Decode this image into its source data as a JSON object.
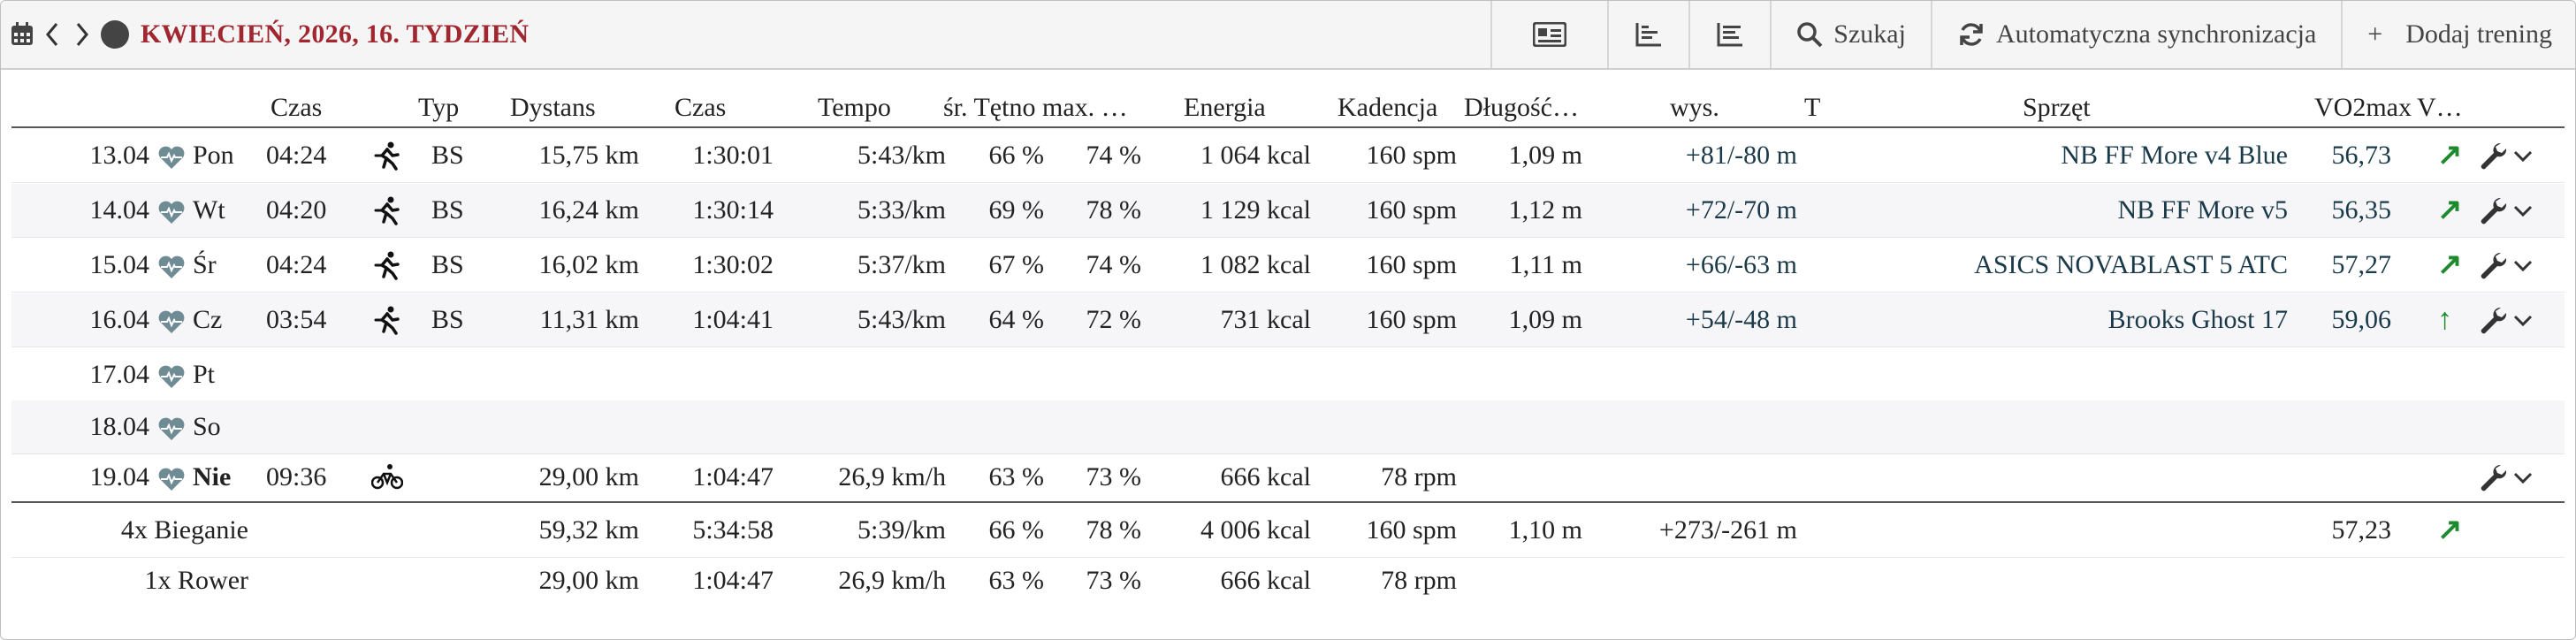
{
  "toolbar": {
    "title": "KWIECIEŃ, 2026, 16. TYDZIEŃ",
    "search_label": "Szukaj",
    "sync_label": "Automatyczna synchronizacja",
    "add_label": "Dodaj trening",
    "add_plus": "+"
  },
  "columns": {
    "czas1": "Czas",
    "typ": "Typ",
    "dystans": "Dystans",
    "czas2": "Czas",
    "tempo": "Tempo",
    "sr": "śr. Tętno",
    "max": "max. …",
    "energia": "Energia",
    "kadencja": "Kadencja",
    "dlugosc": "Długość…",
    "wys": "wys.",
    "t": "T",
    "sprzet": "Sprzęt",
    "vo2": "VO2max",
    "v": "V…"
  },
  "rows": [
    {
      "date": "13.04",
      "day": "Pon",
      "time": "04:24",
      "icon": "running-icon",
      "typ": "BS",
      "dist": "15,75 km",
      "dur": "1:30:01",
      "tempo": "5:43/km",
      "avg": "66 %",
      "max": "74 %",
      "energy": "1 064 kcal",
      "cad": "160 spm",
      "len": "1,09 m",
      "elev": "+81/-80 m",
      "gear": "NB FF More v4 Blue",
      "vo2": "56,73",
      "trend": "↗"
    },
    {
      "date": "14.04",
      "day": "Wt",
      "time": "04:20",
      "icon": "running-icon",
      "typ": "BS",
      "dist": "16,24 km",
      "dur": "1:30:14",
      "tempo": "5:33/km",
      "avg": "69 %",
      "max": "78 %",
      "energy": "1 129 kcal",
      "cad": "160 spm",
      "len": "1,12 m",
      "elev": "+72/-70 m",
      "gear": "NB FF More v5",
      "vo2": "56,35",
      "trend": "↗"
    },
    {
      "date": "15.04",
      "day": "Śr",
      "time": "04:24",
      "icon": "running-icon",
      "typ": "BS",
      "dist": "16,02 km",
      "dur": "1:30:02",
      "tempo": "5:37/km",
      "avg": "67 %",
      "max": "74 %",
      "energy": "1 082 kcal",
      "cad": "160 spm",
      "len": "1,11 m",
      "elev": "+66/-63 m",
      "gear": "ASICS NOVABLAST 5 ATC",
      "vo2": "57,27",
      "trend": "↗"
    },
    {
      "date": "16.04",
      "day": "Cz",
      "time": "03:54",
      "icon": "running-icon",
      "typ": "BS",
      "dist": "11,31 km",
      "dur": "1:04:41",
      "tempo": "5:43/km",
      "avg": "64 %",
      "max": "72 %",
      "energy": "731 kcal",
      "cad": "160 spm",
      "len": "1,09 m",
      "elev": "+54/-48 m",
      "gear": "Brooks Ghost 17",
      "vo2": "59,06",
      "trend": "↑"
    },
    {
      "date": "17.04",
      "day": "Pt"
    },
    {
      "date": "18.04",
      "day": "So"
    },
    {
      "date": "19.04",
      "day": "Nie",
      "time": "09:36",
      "icon": "bike-icon",
      "dist": "29,00 km",
      "dur": "1:04:47",
      "tempo": "26,9 km/h",
      "avg": "63 %",
      "max": "73 %",
      "energy": "666 kcal",
      "cad": "78 rpm"
    }
  ],
  "summary": [
    {
      "label": "4x Bieganie",
      "dist": "59,32 km",
      "dur": "5:34:58",
      "tempo": "5:39/km",
      "avg": "66 %",
      "max": "78 %",
      "energy": "4 006 kcal",
      "cad": "160 spm",
      "len": "1,10 m",
      "elev": "+273/-261 m",
      "vo2": "57,23",
      "trend": "↗"
    },
    {
      "label": "1x Rower",
      "dist": "29,00 km",
      "dur": "1:04:47",
      "tempo": "26,9 km/h",
      "avg": "63 %",
      "max": "73 %",
      "energy": "666 kcal",
      "cad": "78 rpm"
    }
  ],
  "colors": {
    "title": "#a0262f",
    "trend": "#1e8a2e",
    "gear_text": "#1a3a4a",
    "heart": "#6f8c95"
  }
}
